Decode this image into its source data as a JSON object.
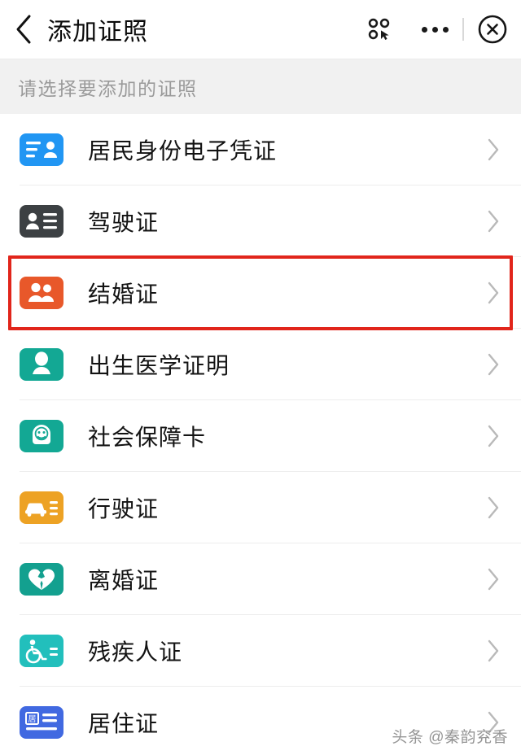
{
  "header": {
    "back_icon": "chevron-left-icon",
    "title": "添加证照",
    "miniprogram_icon": "miniprogram-icon",
    "more_icon": "more-dots-icon",
    "close_icon": "close-circle-icon"
  },
  "section": {
    "label": "请选择要添加的证照"
  },
  "list": {
    "chevron_icon": "chevron-right-icon",
    "items": [
      {
        "label": "居民身份电子凭证",
        "icon": "id-card-icon",
        "color": "#2196f3"
      },
      {
        "label": "驾驶证",
        "icon": "driver-license-icon",
        "color": "#3c4043"
      },
      {
        "label": "结婚证",
        "icon": "couple-icon",
        "color": "#e8582a",
        "highlighted": true
      },
      {
        "label": "出生医学证明",
        "icon": "baby-icon",
        "color": "#13a894"
      },
      {
        "label": "社会保障卡",
        "icon": "social-security-icon",
        "color": "#13a894"
      },
      {
        "label": "行驶证",
        "icon": "vehicle-license-icon",
        "color": "#eda224"
      },
      {
        "label": "离婚证",
        "icon": "broken-heart-icon",
        "color": "#13a08f"
      },
      {
        "label": "残疾人证",
        "icon": "wheelchair-icon",
        "color": "#22bfbc"
      },
      {
        "label": "居住证",
        "icon": "residence-permit-icon",
        "color": "#4169e1"
      }
    ]
  },
  "watermark": {
    "text": "头条 @秦韵兖香"
  },
  "colors": {
    "highlight_border": "#e1251b",
    "section_background": "#f1f1f1",
    "text_primary": "#131313",
    "text_muted": "#9a9a9a"
  }
}
